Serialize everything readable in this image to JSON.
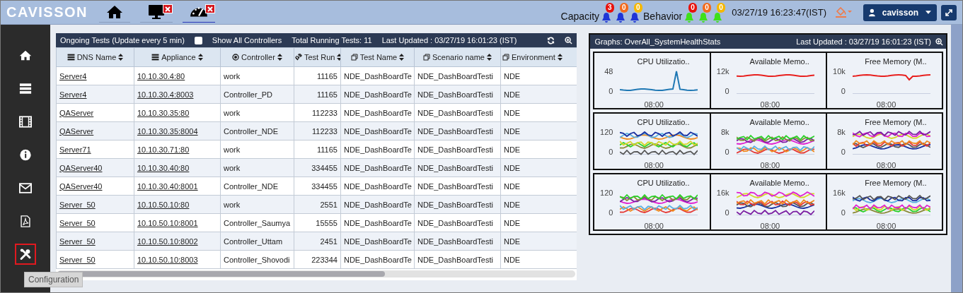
{
  "header": {
    "logo": "CAVISSON",
    "tabs": [
      {
        "kind": "home",
        "selected": false,
        "alert": false
      },
      {
        "kind": "monitor",
        "selected": false,
        "alert": true
      },
      {
        "kind": "gauge",
        "selected": true,
        "alert": true
      }
    ],
    "alert_groups": [
      {
        "label": "Capacity",
        "kind": "capacity",
        "alerts": [
          {
            "count": "3",
            "color": "#e8120c"
          },
          {
            "count": "0",
            "color": "#f26b1d"
          },
          {
            "count": "0",
            "color": "#f5b800"
          }
        ]
      },
      {
        "label": "Behavior",
        "kind": "behavior",
        "alerts": [
          {
            "count": "0",
            "color": "#e8120c"
          },
          {
            "count": "0",
            "color": "#f26b1d"
          },
          {
            "count": "0",
            "color": "#f5b800"
          }
        ]
      }
    ],
    "datetime": "03/27/19 16:23:47(IST)",
    "user": "cavisson"
  },
  "sidebar": {
    "items": [
      {
        "kind": "home",
        "selected": false
      },
      {
        "kind": "servers",
        "selected": false
      },
      {
        "kind": "film",
        "selected": false
      },
      {
        "kind": "info",
        "selected": false
      },
      {
        "kind": "mail",
        "selected": false
      },
      {
        "kind": "pdf",
        "selected": false
      },
      {
        "kind": "tools",
        "selected": true
      }
    ],
    "tooltip": "Configuration"
  },
  "tests_panel": {
    "title": "Ongoing Tests (Update every 5 min)",
    "show_all_controllers": {
      "label": "Show All Controllers",
      "checked": false
    },
    "total": "Total Running Tests: 11",
    "last_updated": "Last Updated : 03/27/19 16:01:23 (IST)",
    "columns": [
      {
        "label": "DNS Name",
        "kind": "link"
      },
      {
        "label": "Appliance",
        "kind": "link"
      },
      {
        "label": "Controller",
        "kind": "text"
      },
      {
        "label": "Test Run",
        "kind": "number"
      },
      {
        "label": "Test Name",
        "kind": "text"
      },
      {
        "label": "Scenario name",
        "kind": "text"
      },
      {
        "label": "Environment",
        "kind": "text"
      }
    ],
    "rows": [
      [
        "Server4",
        "10.10.30.4:80",
        "work",
        "11165",
        "NDE_DashBoardTe",
        "NDE_DashBoardTesti",
        "NDE"
      ],
      [
        "Server4",
        "10.10.30.4:8003",
        "Controller_PD",
        "11165",
        "NDE_DashBoardTe",
        "NDE_DashBoardTesti",
        "NDE"
      ],
      [
        "QAServer",
        "10.10.30.35:80",
        "work",
        "112233",
        "NDE_DashBoardTe",
        "NDE_DashBoardTesti",
        "NDE"
      ],
      [
        "QAServer",
        "10.10.30.35:8004",
        "Controller_NDE",
        "112233",
        "NDE_DashBoardTe",
        "NDE_DashBoardTesti",
        "NDE"
      ],
      [
        "Server71",
        "10.10.30.71:80",
        "work",
        "11165",
        "NDE_DashBoardTe",
        "NDE_DashBoardTesti",
        "NDE"
      ],
      [
        "QAServer40",
        "10.10.30.40:80",
        "work",
        "334455",
        "NDE_DashBoardTe",
        "NDE_DashBoardTesti",
        "NDE"
      ],
      [
        "QAServer40",
        "10.10.30.40:8001",
        "Controller_NDE",
        "334455",
        "NDE_DashBoardTe",
        "NDE_DashBoardTesti",
        "NDE"
      ],
      [
        "Server_50",
        "10.10.50.10:80",
        "work",
        "2551",
        "NDE_DashBoardTe",
        "NDE_DashBoardTesti",
        "NDE"
      ],
      [
        "Server_50",
        "10.10.50.10:8001",
        "Controller_Saumya",
        "15555",
        "NDE_DashBoardTe",
        "NDE_DashBoardTesti",
        "NDE"
      ],
      [
        "Server_50",
        "10.10.50.10:8002",
        "Controller_Uttam",
        "2451",
        "NDE_DashBoardTe",
        "NDE_DashBoardTesti",
        "NDE"
      ],
      [
        "Server_50",
        "10.10.50.10:8003",
        "Controller_Shovodi",
        "223344",
        "NDE_DashBoardTe",
        "NDE_DashBoardTesti",
        "NDE"
      ]
    ]
  },
  "graphs_panel": {
    "title": "Graphs: OverAll_SystemHealthStats",
    "last_updated": "Last Updated : 03/27/19 16:01:23 (IST)",
    "rows": [
      [
        {
          "title": "CPU Utilizatio..",
          "y_max": "48",
          "y_min": "0",
          "x_tick": "08:00"
        },
        {
          "title": "Available Memo..",
          "y_max": "12k",
          "y_min": "0",
          "x_tick": "08:00"
        },
        {
          "title": "Free Memory (M..",
          "y_max": "10k",
          "y_min": "0",
          "x_tick": "08:00"
        }
      ],
      [
        {
          "title": "CPU Utilizatio..",
          "y_max": "120",
          "y_min": "0",
          "x_tick": "08:00"
        },
        {
          "title": "Available Memo..",
          "y_max": "8k",
          "y_min": "0",
          "x_tick": "08:00"
        },
        {
          "title": "Free Memory (M..",
          "y_max": "8k",
          "y_min": "0",
          "x_tick": "08:00"
        }
      ],
      [
        {
          "title": "CPU Utilizatio..",
          "y_max": "120",
          "y_min": "0",
          "x_tick": "08:00"
        },
        {
          "title": "Available Memo..",
          "y_max": "16k",
          "y_min": "0",
          "x_tick": "08:00"
        },
        {
          "title": "Free Memory (M..",
          "y_max": "16k",
          "y_min": "0",
          "x_tick": "08:00"
        }
      ]
    ]
  }
}
